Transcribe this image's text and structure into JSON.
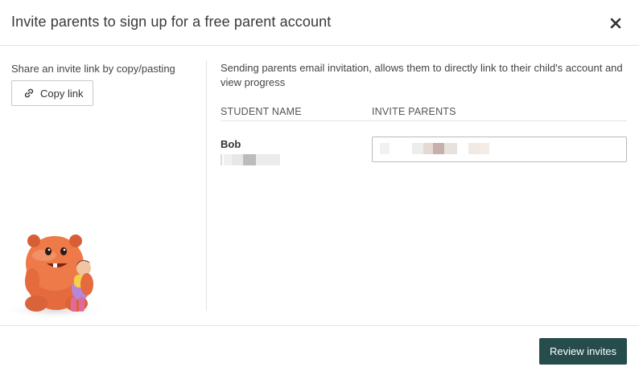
{
  "dialog": {
    "title": "Invite parents to sign up for a free parent account"
  },
  "share": {
    "text": "Share an invite link by copy/pasting",
    "copy_label": "Copy link"
  },
  "invite": {
    "intro": "Sending parents email invitation, allows them to directly link to their child's account and view progress",
    "col_student": "STUDENT NAME",
    "col_invite": "INVITE PARENTS",
    "rows": [
      {
        "name": "Bob"
      }
    ]
  },
  "footer": {
    "review_label": "Review invites"
  },
  "colors": {
    "primary_button": "#264d4b",
    "divider": "#e3e3e3"
  },
  "icons": {
    "close": "close-icon",
    "link": "link-icon"
  }
}
